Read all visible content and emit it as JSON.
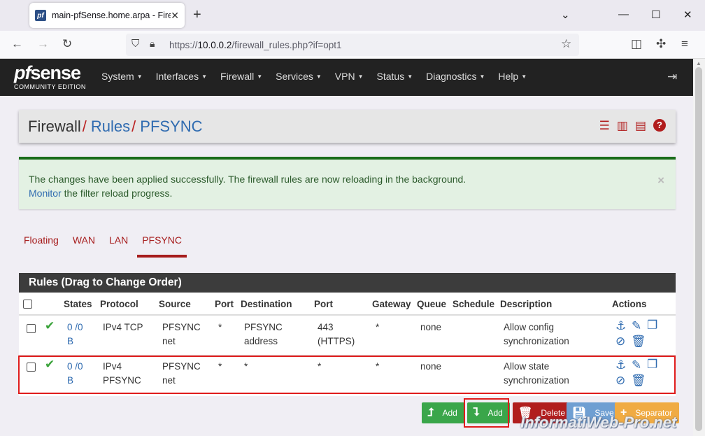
{
  "browser": {
    "tab_title": "main-pfSense.home.arpa - Fire",
    "url_prefix": "https://",
    "url_host": "10.0.0.2",
    "url_path": "/firewall_rules.php?if=opt1"
  },
  "brand": {
    "logo_pf": "pf",
    "logo_sense": "sense",
    "logo_sub": "COMMUNITY EDITION"
  },
  "menu": [
    "System",
    "Interfaces",
    "Firewall",
    "Services",
    "VPN",
    "Status",
    "Diagnostics",
    "Help"
  ],
  "breadcrumb": {
    "part1": "Firewall",
    "part2": "Rules",
    "part3": "PFSYNC",
    "sep": "/"
  },
  "alert": {
    "line1": "The changes have been applied successfully. The firewall rules are now reloading in the background.",
    "link": "Monitor",
    "line2_rest": " the filter reload progress.",
    "close": "×"
  },
  "tabs": [
    "Floating",
    "WAN",
    "LAN",
    "PFSYNC"
  ],
  "active_tab": "PFSYNC",
  "rules": {
    "heading": "Rules (Drag to Change Order)",
    "columns": [
      "States",
      "Protocol",
      "Source",
      "Port",
      "Destination",
      "Port",
      "Gateway",
      "Queue",
      "Schedule",
      "Description",
      "Actions"
    ],
    "rows": [
      {
        "states_1": "0 /0",
        "states_2": "B",
        "protocol_1": "IPv4 TCP",
        "protocol_2": "",
        "source_1": "PFSYNC",
        "source_2": "net",
        "sport": "*",
        "dest_1": "PFSYNC",
        "dest_2": "address",
        "dport_1": "443",
        "dport_2": "(HTTPS)",
        "gateway": "*",
        "queue": "none",
        "schedule": "",
        "desc_1": "Allow config",
        "desc_2": "synchronization"
      },
      {
        "states_1": "0 /0",
        "states_2": "B",
        "protocol_1": "IPv4",
        "protocol_2": "PFSYNC",
        "source_1": "PFSYNC",
        "source_2": "net",
        "sport": "*",
        "dest_1": "*",
        "dest_2": "",
        "dport_1": "*",
        "dport_2": "",
        "gateway": "*",
        "queue": "none",
        "schedule": "",
        "desc_1": "Allow state",
        "desc_2": "synchronization"
      }
    ]
  },
  "buttons": {
    "add_top": "Add",
    "add_bottom": "Add",
    "delete": "Delete",
    "save": "Save",
    "separator": "Separator"
  },
  "watermark": "InformatiWeb-Pro.net",
  "colors": {
    "pf_red": "#b11d1d",
    "link_blue": "#2f6bb0",
    "success_green": "#3aa64a",
    "highlight": "#e01c1c"
  }
}
